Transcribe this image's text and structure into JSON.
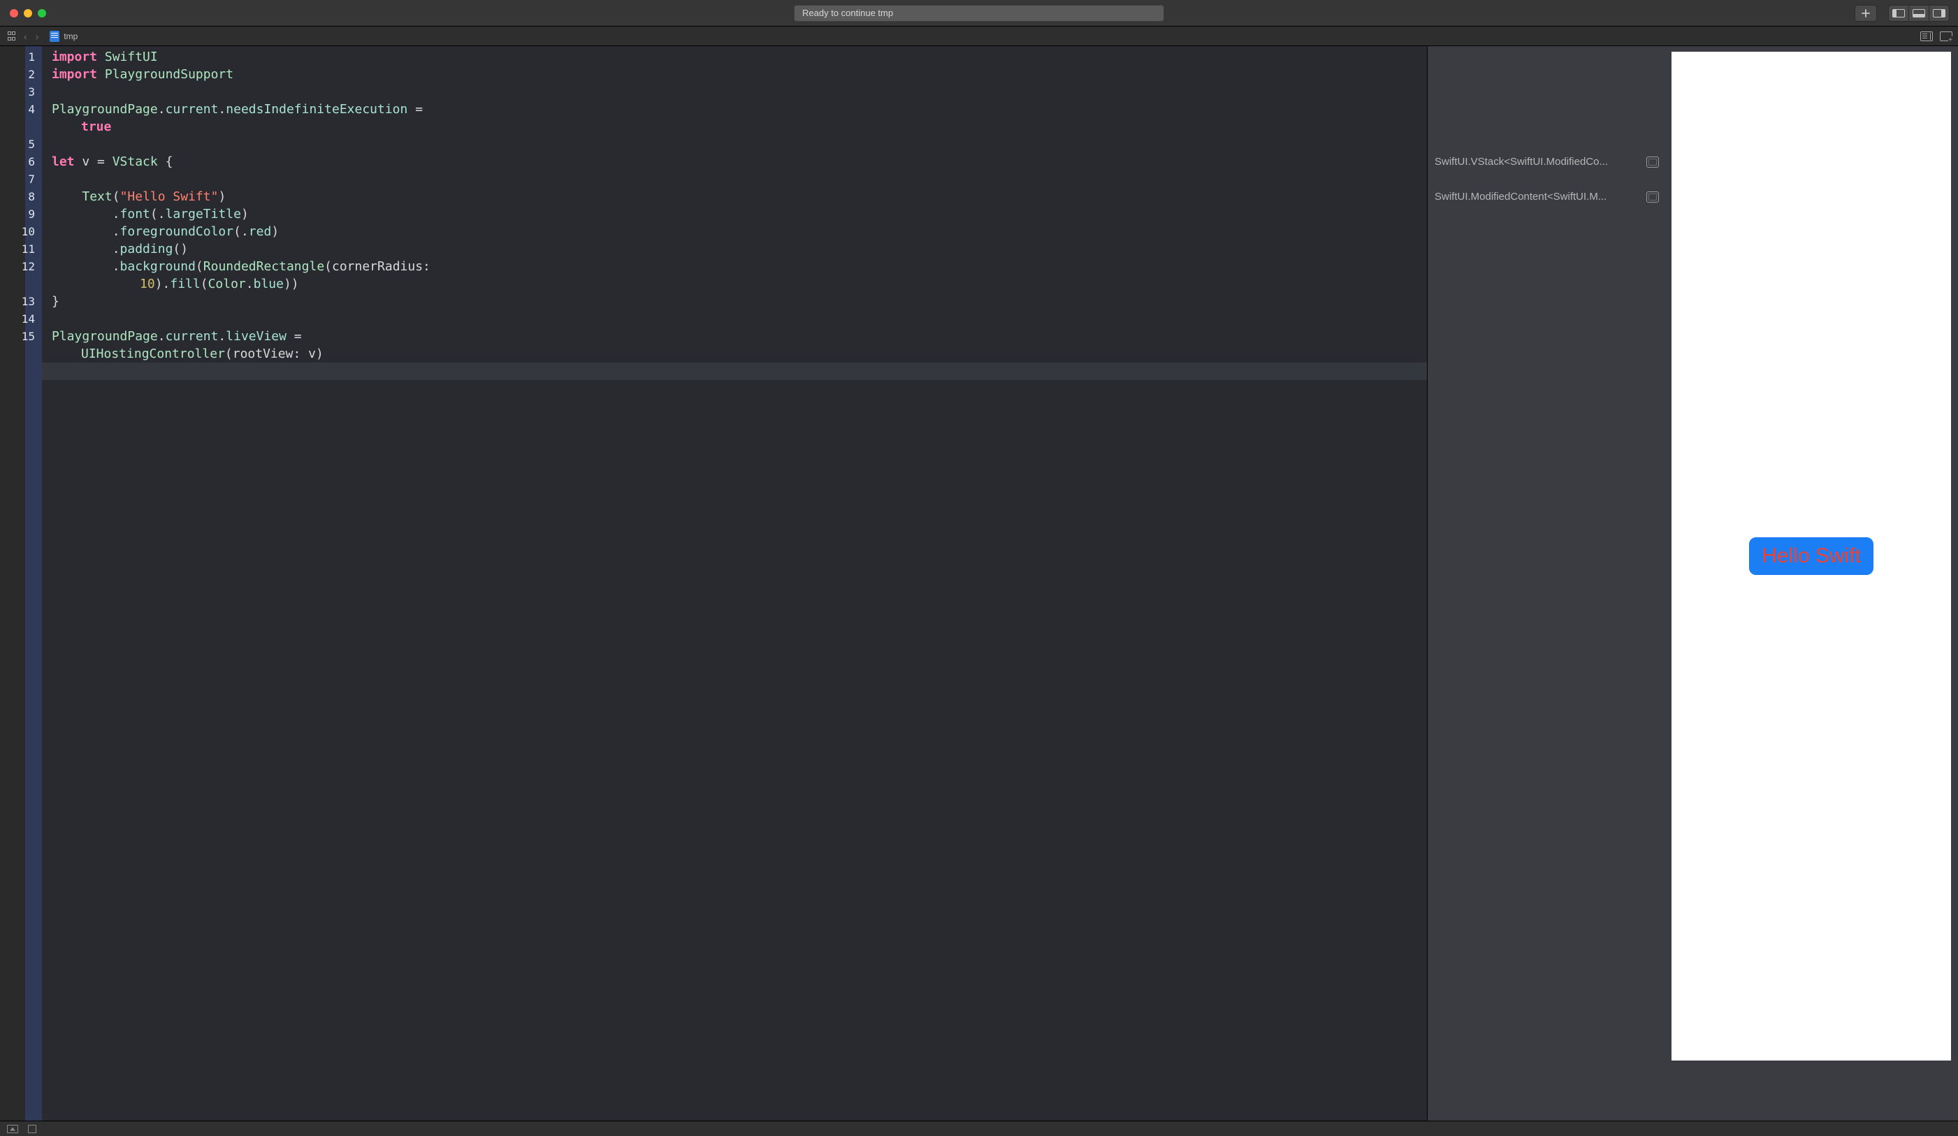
{
  "titlebar": {
    "status": "Ready to continue tmp"
  },
  "tab": {
    "filename": "tmp"
  },
  "code": {
    "lines": [
      [
        {
          "c": "kw",
          "t": "import"
        },
        {
          "c": "op",
          "t": " "
        },
        {
          "c": "type",
          "t": "SwiftUI"
        }
      ],
      [
        {
          "c": "kw",
          "t": "import"
        },
        {
          "c": "op",
          "t": " "
        },
        {
          "c": "type",
          "t": "PlaygroundSupport"
        }
      ],
      [],
      [
        {
          "c": "type",
          "t": "PlaygroundPage"
        },
        {
          "c": "op",
          "t": "."
        },
        {
          "c": "member",
          "t": "current"
        },
        {
          "c": "op",
          "t": "."
        },
        {
          "c": "member",
          "t": "needsIndefiniteExecution"
        },
        {
          "c": "op",
          "t": " = "
        }
      ],
      [
        {
          "c": "kw",
          "t": "true"
        }
      ],
      [],
      [
        {
          "c": "kw",
          "t": "let"
        },
        {
          "c": "op",
          "t": " v = "
        },
        {
          "c": "type",
          "t": "VStack"
        },
        {
          "c": "op",
          "t": " {"
        }
      ],
      [],
      [
        {
          "c": "op",
          "t": "    "
        },
        {
          "c": "type",
          "t": "Text"
        },
        {
          "c": "op",
          "t": "("
        },
        {
          "c": "str",
          "t": "\"Hello Swift\""
        },
        {
          "c": "op",
          "t": ")"
        }
      ],
      [
        {
          "c": "op",
          "t": "        ."
        },
        {
          "c": "member",
          "t": "font"
        },
        {
          "c": "op",
          "t": "(."
        },
        {
          "c": "member",
          "t": "largeTitle"
        },
        {
          "c": "op",
          "t": ")"
        }
      ],
      [
        {
          "c": "op",
          "t": "        ."
        },
        {
          "c": "member",
          "t": "foregroundColor"
        },
        {
          "c": "op",
          "t": "(."
        },
        {
          "c": "member",
          "t": "red"
        },
        {
          "c": "op",
          "t": ")"
        }
      ],
      [
        {
          "c": "op",
          "t": "        ."
        },
        {
          "c": "member",
          "t": "padding"
        },
        {
          "c": "op",
          "t": "()"
        }
      ],
      [
        {
          "c": "op",
          "t": "        ."
        },
        {
          "c": "member",
          "t": "background"
        },
        {
          "c": "op",
          "t": "("
        },
        {
          "c": "type",
          "t": "RoundedRectangle"
        },
        {
          "c": "op",
          "t": "(cornerRadius: "
        }
      ],
      [
        {
          "c": "num",
          "t": "10"
        },
        {
          "c": "op",
          "t": ")."
        },
        {
          "c": "member",
          "t": "fill"
        },
        {
          "c": "op",
          "t": "("
        },
        {
          "c": "type",
          "t": "Color"
        },
        {
          "c": "op",
          "t": "."
        },
        {
          "c": "member",
          "t": "blue"
        },
        {
          "c": "op",
          "t": "))"
        }
      ],
      [
        {
          "c": "op",
          "t": "}"
        }
      ],
      [],
      [
        {
          "c": "type",
          "t": "PlaygroundPage"
        },
        {
          "c": "op",
          "t": "."
        },
        {
          "c": "member",
          "t": "current"
        },
        {
          "c": "op",
          "t": "."
        },
        {
          "c": "member",
          "t": "liveView"
        },
        {
          "c": "op",
          "t": " = "
        }
      ],
      [
        {
          "c": "type",
          "t": "UIHostingController"
        },
        {
          "c": "op",
          "t": "(rootView: v)"
        }
      ]
    ],
    "line_numbers": [
      "1",
      "2",
      "3",
      "4",
      "",
      "5",
      "6",
      "7",
      "8",
      "9",
      "10",
      "11",
      "12",
      "",
      "13",
      "14",
      "15",
      ""
    ],
    "wrap_indices": [
      4,
      13,
      17
    ],
    "wrap2_indices": [
      13
    ],
    "cursor_index": 18
  },
  "results": {
    "rows": [
      {
        "at": 6,
        "text": "SwiftUI.VStack<SwiftUI.ModifiedCo..."
      },
      {
        "at": 8,
        "text": "SwiftUI.ModifiedContent<SwiftUI.M..."
      }
    ]
  },
  "preview": {
    "hello_text": "Hello Swift"
  }
}
